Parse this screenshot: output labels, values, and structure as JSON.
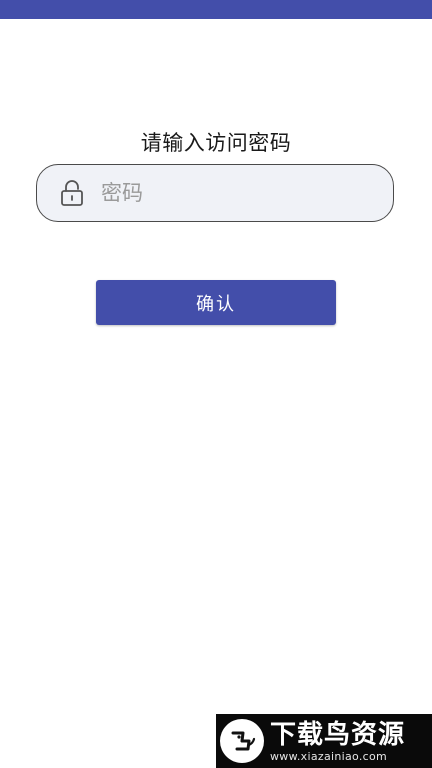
{
  "header": {
    "accent_color": "#434eaa"
  },
  "prompt": {
    "text": "请输入访问密码"
  },
  "password": {
    "icon": "lock-icon",
    "placeholder": "密码",
    "value": ""
  },
  "confirm_button": {
    "label": "确认"
  },
  "watermark": {
    "logo_icon": "bird-logo-icon",
    "title": "下载鸟资源",
    "url": "www.xiazainiao.com"
  }
}
